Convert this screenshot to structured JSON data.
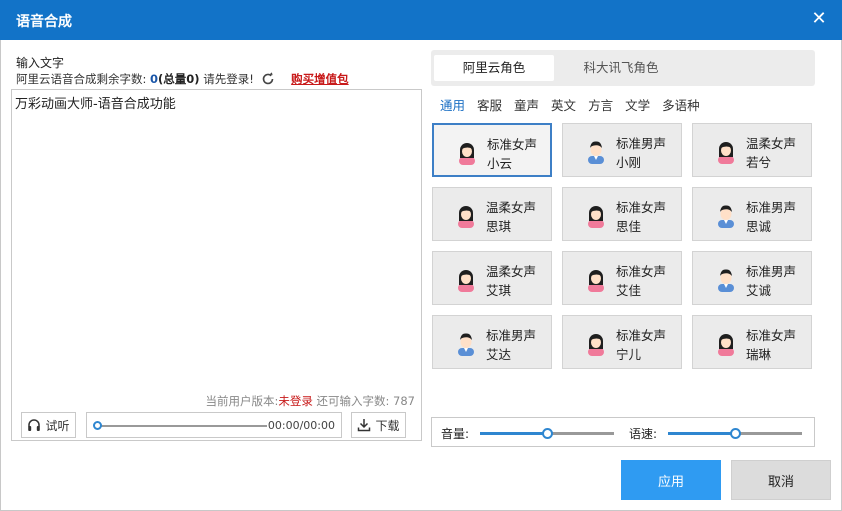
{
  "window": {
    "title": "语音合成",
    "close_icon": "close-icon"
  },
  "left": {
    "input_label": "输入文字",
    "quota_prefix": "阿里云语音合成剩余字数: ",
    "quota_num": "0",
    "quota_total": "(总量0)",
    "login_hint": " 请先登录!",
    "buy_link": "购买增值包",
    "editor_text": "万彩动画大师-语音合成功能",
    "status_prefix": "当前用户版本:",
    "status_red": "未登录",
    "status_suffix": " 还可输入字数: 787",
    "listen_label": "试听",
    "download_label": "下载",
    "time": "00:00/00:00",
    "progress": 0
  },
  "right": {
    "vendor_tabs": [
      "阿里云角色",
      "科大讯飞角色"
    ],
    "active_vendor": 0,
    "categories": [
      "通用",
      "客服",
      "童声",
      "英文",
      "方言",
      "文学",
      "多语种"
    ],
    "active_category": 0,
    "voices": [
      {
        "line1": "标准女声",
        "line2": "小云",
        "gender": "female",
        "selected": true
      },
      {
        "line1": "标准男声",
        "line2": "小刚",
        "gender": "male",
        "selected": false
      },
      {
        "line1": "温柔女声",
        "line2": "若兮",
        "gender": "female",
        "selected": false
      },
      {
        "line1": "温柔女声",
        "line2": "思琪",
        "gender": "female",
        "selected": false
      },
      {
        "line1": "标准女声",
        "line2": "思佳",
        "gender": "female",
        "selected": false
      },
      {
        "line1": "标准男声",
        "line2": "思诚",
        "gender": "male",
        "selected": false
      },
      {
        "line1": "温柔女声",
        "line2": "艾琪",
        "gender": "female",
        "selected": false
      },
      {
        "line1": "标准女声",
        "line2": "艾佳",
        "gender": "female",
        "selected": false
      },
      {
        "line1": "标准男声",
        "line2": "艾诚",
        "gender": "male",
        "selected": false
      },
      {
        "line1": "标准男声",
        "line2": "艾达",
        "gender": "male",
        "selected": false
      },
      {
        "line1": "标准女声",
        "line2": "宁儿",
        "gender": "female",
        "selected": false
      },
      {
        "line1": "标准女声",
        "line2": "瑞琳",
        "gender": "female",
        "selected": false
      }
    ],
    "volume_label": "音量:",
    "volume_level": 0.5,
    "speed_label": "语速:",
    "speed_level": 0.5
  },
  "footer": {
    "apply_label": "应用",
    "cancel_label": "取消"
  },
  "colors": {
    "accent": "#1273c8",
    "apply": "#2f9bf2",
    "link_red": "#c81a1a",
    "slider": "#2e86d0"
  }
}
